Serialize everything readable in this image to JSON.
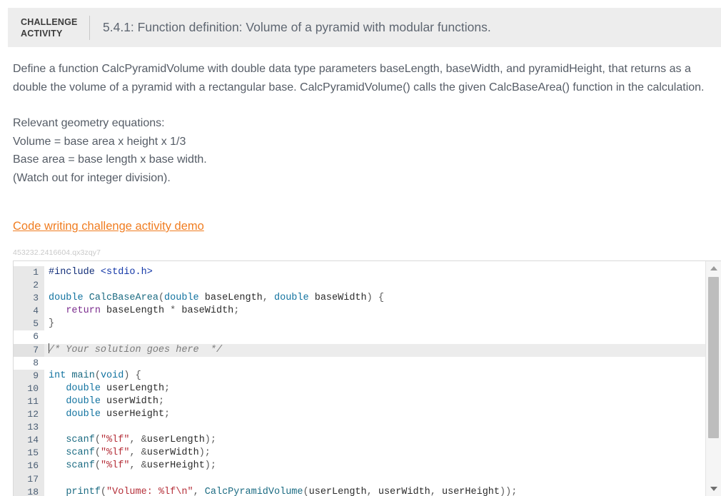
{
  "header": {
    "badge_line1": "CHALLENGE",
    "badge_line2": "ACTIVITY",
    "title": "5.4.1: Function definition: Volume of a pyramid with modular functions.",
    "accent_color": "#1b7fc0",
    "background_color": "#ededed"
  },
  "prose": {
    "paragraph1": "Define a function CalcPyramidVolume with double data type parameters baseLength, baseWidth, and pyramidHeight, that returns as a double the volume of a pyramid with a rectangular base. CalcPyramidVolume() calls the given CalcBaseArea() function in the calculation.",
    "equations_heading": "Relevant geometry equations:",
    "equation1": "Volume = base area x height x 1/3",
    "equation2": "Base area = base length x base width.",
    "equation3": "(Watch out for integer division)."
  },
  "demo_link": {
    "label": "Code writing challenge activity demo",
    "color": "#f07d21"
  },
  "activity_id": "453232.2416604.qx3zqy7",
  "editor": {
    "active_line": 7,
    "readonly_ranges": "1-5, 9-18",
    "lines": [
      {
        "n": "1",
        "readonly": true,
        "active": false
      },
      {
        "n": "2",
        "readonly": true,
        "active": false
      },
      {
        "n": "3",
        "readonly": true,
        "active": false
      },
      {
        "n": "4",
        "readonly": true,
        "active": false
      },
      {
        "n": "5",
        "readonly": true,
        "active": false
      },
      {
        "n": "6",
        "readonly": false,
        "active": false
      },
      {
        "n": "7",
        "readonly": false,
        "active": true
      },
      {
        "n": "8",
        "readonly": false,
        "active": false
      },
      {
        "n": "9",
        "readonly": true,
        "active": false
      },
      {
        "n": "10",
        "readonly": true,
        "active": false
      },
      {
        "n": "11",
        "readonly": true,
        "active": false
      },
      {
        "n": "12",
        "readonly": true,
        "active": false
      },
      {
        "n": "13",
        "readonly": true,
        "active": false
      },
      {
        "n": "14",
        "readonly": true,
        "active": false
      },
      {
        "n": "15",
        "readonly": true,
        "active": false
      },
      {
        "n": "16",
        "readonly": true,
        "active": false
      },
      {
        "n": "17",
        "readonly": true,
        "active": false
      },
      {
        "n": "18",
        "readonly": true,
        "active": false
      }
    ],
    "code_text": [
      "#include <stdio.h>",
      "",
      "double CalcBaseArea(double baseLength, double baseWidth) {",
      "   return baseLength * baseWidth;",
      "}",
      "",
      "/* Your solution goes here  */",
      "",
      "int main(void) {",
      "   double userLength;",
      "   double userWidth;",
      "   double userHeight;",
      "",
      "   scanf(\"%lf\", &userLength);",
      "   scanf(\"%lf\", &userWidth);",
      "   scanf(\"%lf\", &userHeight);",
      "",
      "   printf(\"Volume: %lf\\n\", CalcPyramidVolume(userLength, userWidth, userHeight));"
    ],
    "scrollbar": {
      "up_arrow": "scroll-up",
      "down_arrow": "scroll-down"
    }
  }
}
